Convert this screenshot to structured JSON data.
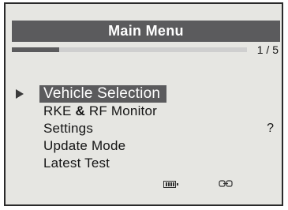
{
  "header": {
    "title": "Main Menu"
  },
  "pagination": {
    "current": 1,
    "total": 5,
    "label": "1 / 5",
    "progress_fraction": 0.2
  },
  "menu": {
    "items": [
      {
        "label": "Vehicle Selection",
        "selected": true
      },
      {
        "label_parts": [
          "RKE",
          "&",
          "RF Monitor"
        ],
        "selected": false
      },
      {
        "label": "Settings",
        "selected": false,
        "suffix": "?"
      },
      {
        "label": "Update Mode",
        "selected": false
      },
      {
        "label": "Latest Test",
        "selected": false
      }
    ]
  },
  "status_bar": {
    "icons": [
      "battery-icon",
      "connection-icon"
    ]
  },
  "colors": {
    "highlight": "#5b5b5d",
    "screen_background": "#e6e6e2",
    "text": "#141414"
  }
}
